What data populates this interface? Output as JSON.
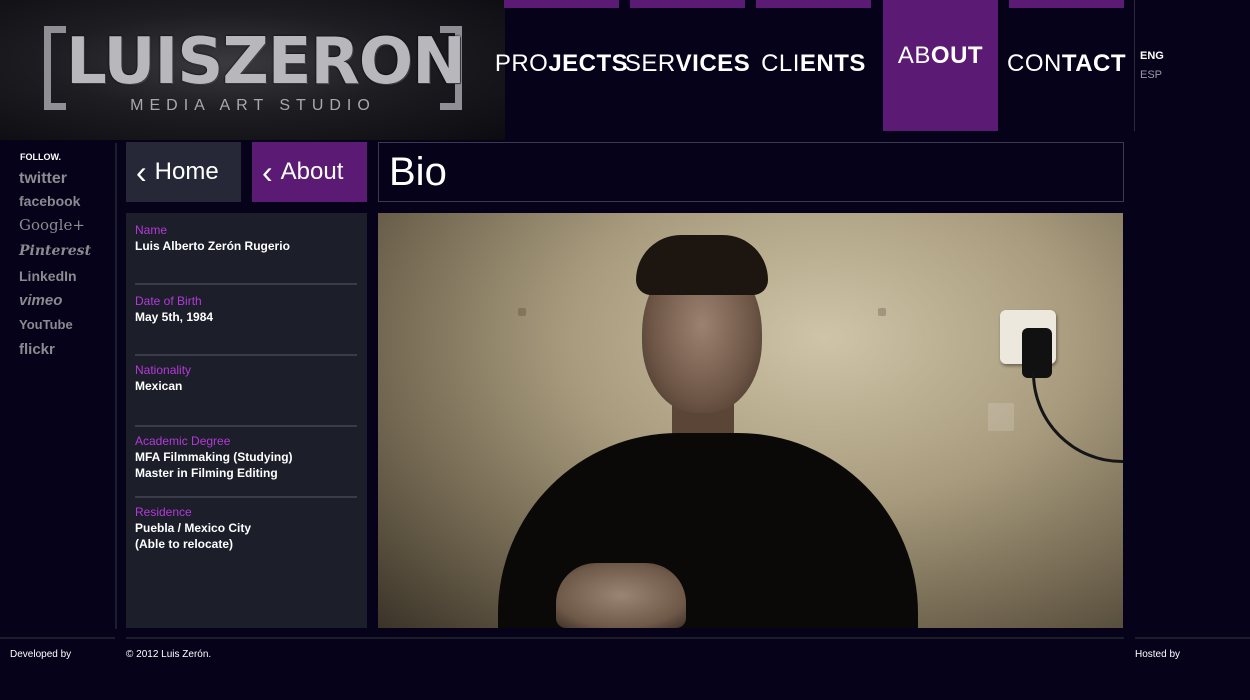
{
  "logo": {
    "title": "LUISZERON",
    "subtitle": "MEDIA ART STUDIO"
  },
  "nav": [
    {
      "thin": "PRO",
      "bold": "JECTS"
    },
    {
      "thin": "SER",
      "bold": "VICES"
    },
    {
      "thin": "CLI",
      "bold": "ENTS"
    },
    {
      "thin": "AB",
      "bold": "OUT"
    },
    {
      "thin": "CON",
      "bold": "TACT"
    }
  ],
  "lang": {
    "eng": "ENG",
    "esp": "ESP"
  },
  "sidebar": {
    "follow": "FOLLOW.",
    "social": [
      "twitter",
      "facebook",
      "Google+",
      "Pinterest",
      "LinkedIn",
      "vimeo",
      "YouTube",
      "flickr"
    ]
  },
  "crumbs": {
    "home": "Home",
    "about": "About",
    "chevron": "‹"
  },
  "page_title": "Bio",
  "info": [
    {
      "label": "Name",
      "value": "Luis Alberto Zerón Rugerio"
    },
    {
      "label": "Date of Birth",
      "value": "May 5th, 1984"
    },
    {
      "label": "Nationality",
      "value": "Mexican"
    },
    {
      "label": "Academic Degree",
      "value": "MFA Filmmaking (Studying)",
      "value2": "Master in Filming Editing"
    },
    {
      "label": "Residence",
      "value": "Puebla / Mexico City",
      "value2": "(Able to relocate)"
    }
  ],
  "footer": {
    "developed": "Developed by",
    "copyright": "© 2012 Luis Zerón.",
    "hosted": "Hosted by"
  },
  "colors": {
    "accent": "#5b1a73",
    "label": "#b43ad8",
    "background": "#050219"
  }
}
